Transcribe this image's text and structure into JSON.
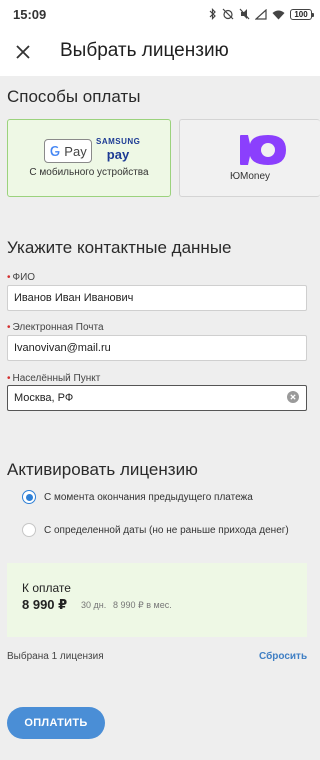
{
  "status_bar": {
    "time": "15:09",
    "battery": "100"
  },
  "header": {
    "title": "Выбрать лицензию"
  },
  "payment_methods": {
    "title": "Способы оплаты",
    "gpay": {
      "logo_text": "Pay",
      "samsung_top": "SAMSUNG",
      "samsung_bottom": "pay",
      "label": "С мобильного устройства",
      "selected": true
    },
    "yoomoney": {
      "label": "ЮMoney",
      "brand_color": "#8b3ffd"
    }
  },
  "contact": {
    "title": "Укажите контактные данные",
    "fields": [
      {
        "label": "ФИО",
        "value": "Иванов Иван Иванович",
        "required": true
      },
      {
        "label": "Электронная Почта",
        "value": "Ivanovivan@mail.ru",
        "required": true
      },
      {
        "label": "Населённый Пункт",
        "value": "Москва, РФ",
        "required": true
      }
    ]
  },
  "activation": {
    "title": "Активировать лицензию",
    "options": [
      {
        "label": "С момента окончания предыдущего платежа",
        "selected": true
      },
      {
        "label": "С определенной даты (но не раньше прихода денег)",
        "selected": false
      }
    ]
  },
  "payment": {
    "title": "К оплате",
    "amount": "8 990 ₽",
    "period": "30 дн.",
    "monthly": "8 990 ₽ в мес."
  },
  "summary": {
    "selected_text": "Выбрана 1 лицензия",
    "reset": "Сбросить"
  },
  "actions": {
    "pay_button": "ОПЛАТИТЬ"
  },
  "colors": {
    "accent": "#4a8ed6",
    "selected_bg": "#eef8e5",
    "selected_border": "#9bd27d",
    "required": "#d32f2f"
  }
}
